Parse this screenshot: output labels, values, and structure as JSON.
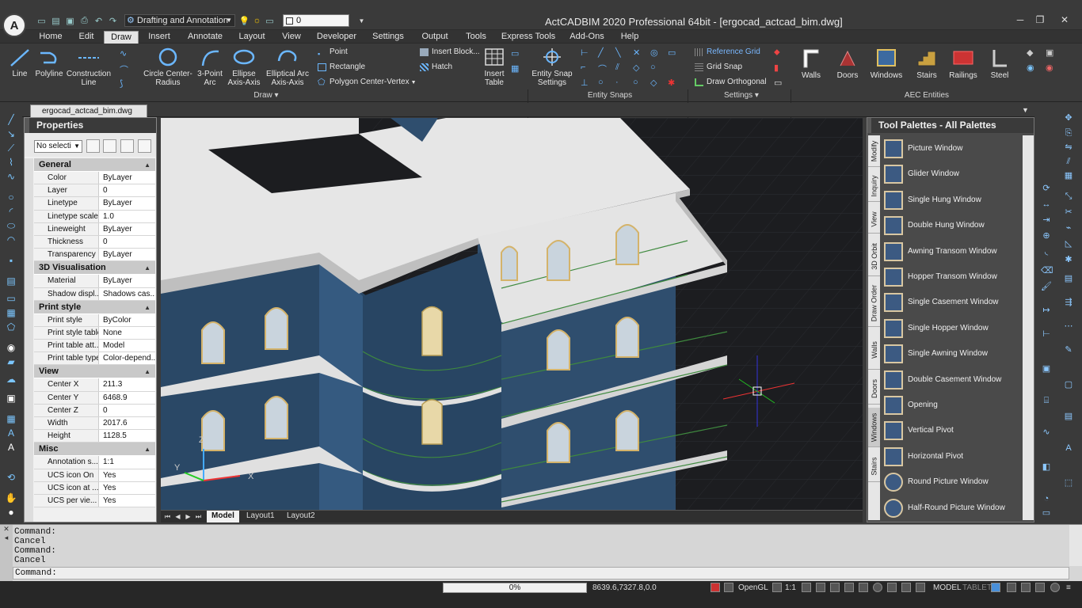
{
  "app": {
    "title": "ActCADBIM 2020 Professional 64bit - [ergocad_actcad_bim.dwg]",
    "logo_text": "A"
  },
  "quick_access": {
    "workspace": "Drafting and Annotation",
    "layer": "0"
  },
  "menu": [
    "Home",
    "Edit",
    "Draw",
    "Insert",
    "Annotate",
    "Layout",
    "View",
    "Developer",
    "Settings",
    "Output",
    "Tools",
    "Express Tools",
    "Add-Ons",
    "Help"
  ],
  "menu_active": "Draw",
  "ribbon": {
    "draw": {
      "line": "Line",
      "polyline": "Polyline",
      "construction_line": "Construction Line",
      "circle": "Circle Center-Radius",
      "arc": "3-Point Arc",
      "ellipse": "Ellipse Axis-Axis",
      "elliptical_arc": "Elliptical Arc Axis-Axis",
      "point": "Point",
      "rectangle": "Rectangle",
      "polygon": "Polygon Center-Vertex",
      "insert_block": "Insert Block...",
      "hatch": "Hatch",
      "insert_table": "Insert Table",
      "group_label": "Draw"
    },
    "snaps": {
      "settings_btn": "Entity Snap Settings",
      "group_label": "Entity Snaps"
    },
    "settings": {
      "reference_grid": "Reference Grid",
      "grid_snap": "Grid Snap",
      "draw_orthogonal": "Draw Orthogonal",
      "group_label": "Settings"
    },
    "aec": {
      "walls": "Walls",
      "doors": "Doors",
      "windows": "Windows",
      "stairs": "Stairs",
      "railings": "Railings",
      "steel": "Steel",
      "group_label": "AEC Entities"
    }
  },
  "document_tab": "ergocad_actcad_bim.dwg",
  "properties": {
    "title": "Properties",
    "selection": "No selecti",
    "sections": [
      {
        "name": "General",
        "rows": [
          {
            "k": "Color",
            "v": "ByLayer"
          },
          {
            "k": "Layer",
            "v": "0"
          },
          {
            "k": "Linetype",
            "v": "ByLayer"
          },
          {
            "k": "Linetype scale",
            "v": "1.0"
          },
          {
            "k": "Lineweight",
            "v": "ByLayer"
          },
          {
            "k": "Thickness",
            "v": "0"
          },
          {
            "k": "Transparency",
            "v": "ByLayer"
          }
        ]
      },
      {
        "name": "3D Visualisation",
        "rows": [
          {
            "k": "Material",
            "v": "ByLayer"
          },
          {
            "k": "Shadow displ...",
            "v": "Shadows cas..."
          }
        ]
      },
      {
        "name": "Print style",
        "rows": [
          {
            "k": "Print style",
            "v": "ByColor"
          },
          {
            "k": "Print style table",
            "v": "None"
          },
          {
            "k": "Print table att...",
            "v": "Model"
          },
          {
            "k": "Print table type",
            "v": "Color-depend..."
          }
        ]
      },
      {
        "name": "View",
        "rows": [
          {
            "k": "Center X",
            "v": "211.3"
          },
          {
            "k": "Center Y",
            "v": "6468.9"
          },
          {
            "k": "Center Z",
            "v": "0"
          },
          {
            "k": "Width",
            "v": "2017.6"
          },
          {
            "k": "Height",
            "v": "1128.5"
          }
        ]
      },
      {
        "name": "Misc",
        "rows": [
          {
            "k": "Annotation s...",
            "v": "1:1"
          },
          {
            "k": "UCS icon On",
            "v": "Yes"
          },
          {
            "k": "UCS icon at ...",
            "v": "Yes"
          },
          {
            "k": "UCS per vie...",
            "v": "Yes"
          }
        ]
      }
    ]
  },
  "viewport": {
    "ucs_x": "X",
    "ucs_y": "Y",
    "ucs_z": "Z"
  },
  "layout_tabs": [
    "Model",
    "Layout1",
    "Layout2"
  ],
  "tool_palette": {
    "title": "Tool Palettes - All Palettes",
    "tabs": [
      "Modify",
      "Inquiry",
      "View",
      "3D Orbit",
      "Draw Order",
      "Walls",
      "Doors",
      "Windows",
      "Stairs"
    ],
    "active_tab": "Windows",
    "items": [
      "Picture Window",
      "Glider Window",
      "Single Hung Window",
      "Double Hung Window",
      "Awning Transom Window",
      "Hopper Transom Window",
      "Single Casement Window",
      "Single Hopper Window",
      "Single Awning Window",
      "Double Casement Window",
      "Opening",
      "Vertical Pivot",
      "Horizontal Pivot",
      "Round Picture Window",
      "Half-Round Picture Window"
    ]
  },
  "command": {
    "history": [
      "Command:",
      "Cancel",
      "Command:",
      "Cancel"
    ],
    "prompt": "Command:"
  },
  "status": {
    "progress_label": "0%",
    "progress": 0.0,
    "coords": "8639.6,7327.8,0.0",
    "render": "OpenGL",
    "scale": "1:1",
    "model": "MODEL",
    "tablet": "TABLET"
  },
  "colors": {
    "accent": "#4a90d9",
    "building": "#2f4e6e",
    "roof": "#e8e8e8",
    "railing": "#3f8a3f"
  }
}
